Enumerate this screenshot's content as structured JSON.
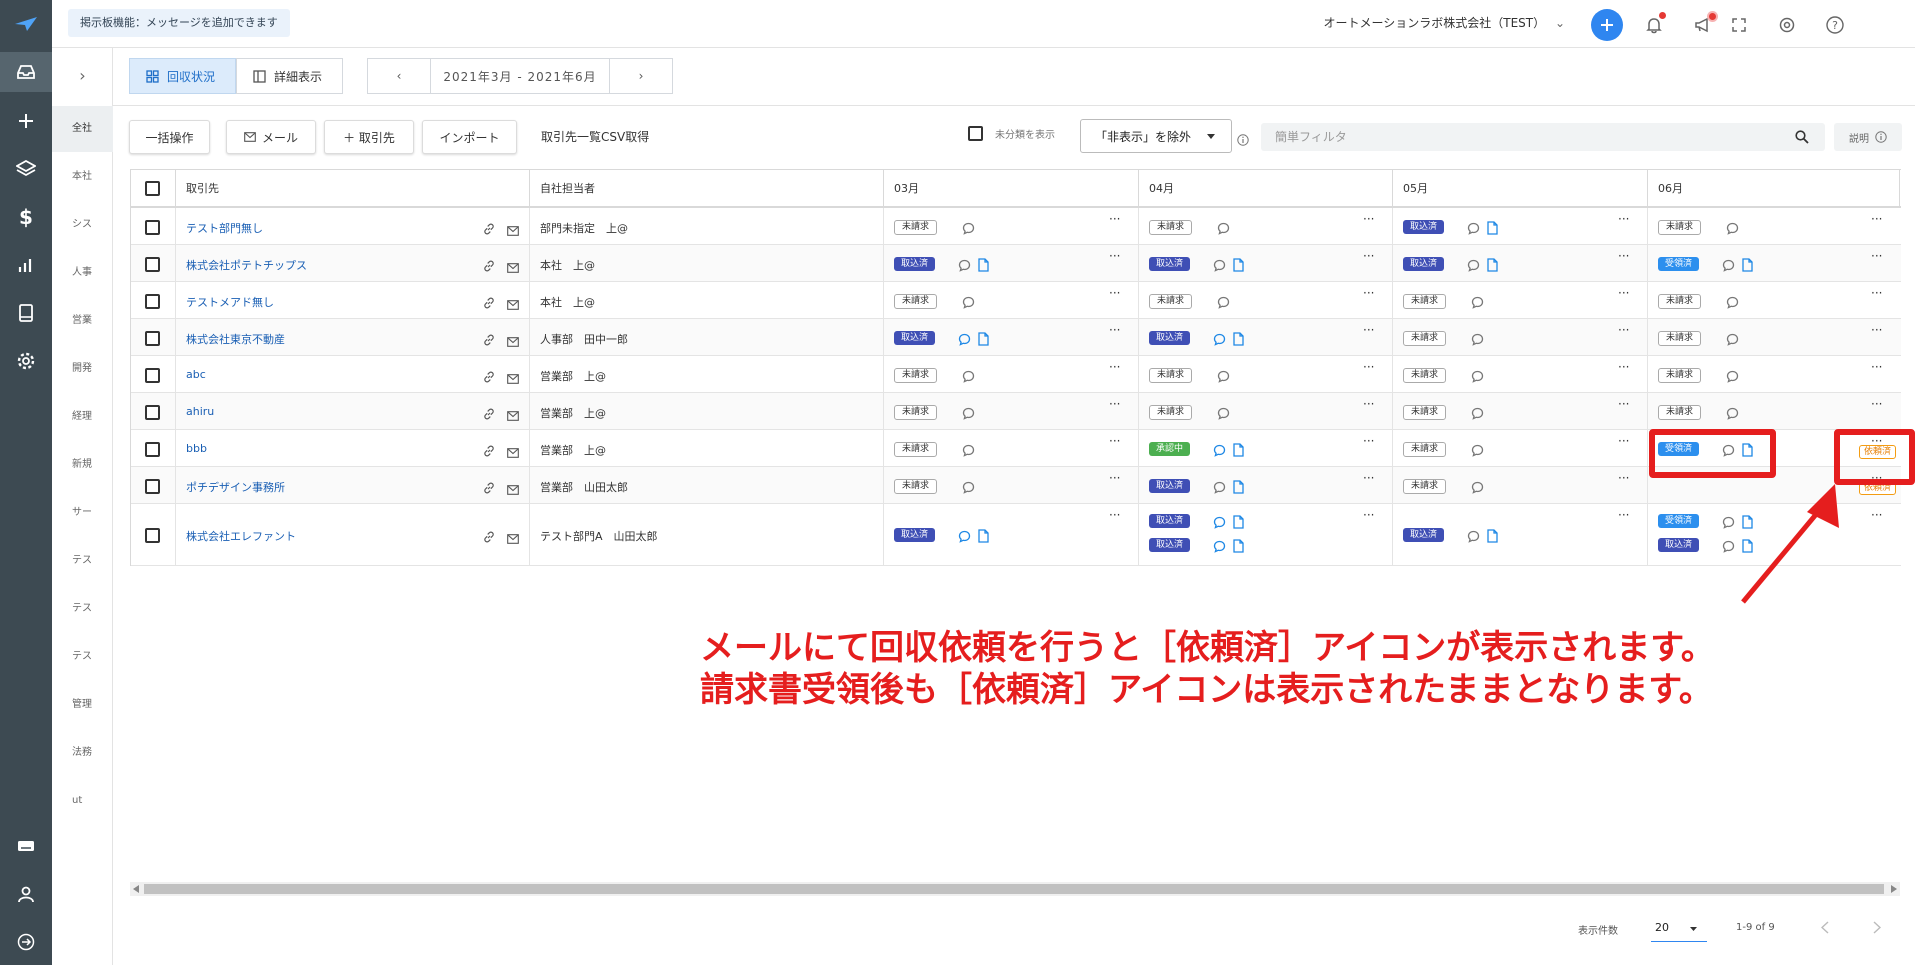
{
  "header": {
    "banner": "掲示板機能：メッセージを追加できます",
    "company": "オートメーションラボ株式会社（TEST）",
    "company_chevron": "⌄"
  },
  "subnav": {
    "items": [
      "全社",
      "本社",
      "シス",
      "人事",
      "営業",
      "開発",
      "経理",
      "新規",
      "サー",
      "テス",
      "テス",
      "テス",
      "管理",
      "法務",
      "ut"
    ]
  },
  "view": {
    "tab_collection": "回収状況",
    "tab_detail": "詳細表示",
    "period": "2021年3月 - 2021年6月",
    "prev": "‹",
    "next": "›"
  },
  "toolbar": {
    "bulk": "一括操作",
    "mail": "メール",
    "client": "＋ 取引先",
    "import": "インポート",
    "csv": "取引先一覧CSV取得",
    "show_unclassified": "未分類を表示",
    "exclude_select": "「非表示」を除外",
    "filter_placeholder": "簡単フィルタ",
    "help": "説明"
  },
  "table": {
    "headers": [
      "取引先",
      "自社担当者",
      "03月",
      "04月",
      "05月",
      "06月"
    ],
    "rows": [
      {
        "name": "テスト部門無し",
        "person": "部門未指定　上@"
      },
      {
        "name": "株式会社ポテトチップス",
        "person": "本社　上@"
      },
      {
        "name": "テストメアド無し",
        "person": "本社　上@"
      },
      {
        "name": "株式会社東京不動産",
        "person": "人事部　田中一郎"
      },
      {
        "name": "abc",
        "person": "営業部　上@"
      },
      {
        "name": "ahiru",
        "person": "営業部　上@"
      },
      {
        "name": "bbb",
        "person": "営業部　上@"
      },
      {
        "name": "ポチデザイン事務所",
        "person": "営業部　山田太郎"
      },
      {
        "name": "株式会社エレファント",
        "person": "テスト部門A　山田太郎"
      }
    ],
    "status": {
      "unbilled": "未請求",
      "imported": "取込済",
      "received": "受領済",
      "approving": "承認中",
      "requested": "依頼済"
    },
    "more": "···"
  },
  "footer": {
    "per_page_label": "表示件数",
    "per_page": "20",
    "range": "1-9 of 9"
  },
  "annotation": {
    "line1": "メールにて回収依頼を行うと［依頼済］アイコンが表示されます。",
    "line2": "請求書受領後も［依頼済］アイコンは表示されたままとなります。"
  },
  "colors": {
    "rail": "#3d4a52",
    "primary": "#2f86f0",
    "imported": "#3f4fb5",
    "received": "#2c8fee",
    "approving": "#4caf50",
    "requested": "#f39c12",
    "annotation": "#e51e1e"
  }
}
